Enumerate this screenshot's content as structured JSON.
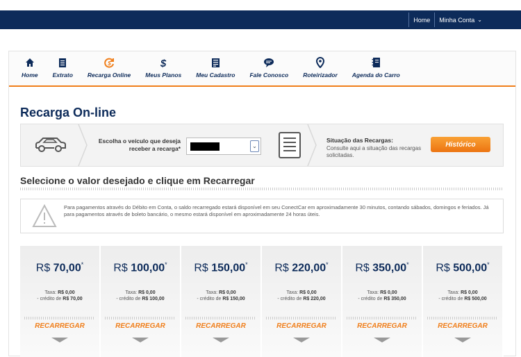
{
  "topnav": {
    "home": "Home",
    "account": "Minha Conta"
  },
  "menu": [
    {
      "label": "Home",
      "icon": "home-icon"
    },
    {
      "label": "Extrato",
      "icon": "statement-icon"
    },
    {
      "label": "Recarga Online",
      "icon": "recharge-icon"
    },
    {
      "label": "Meus Planos",
      "icon": "dollar-icon"
    },
    {
      "label": "Meu Cadastro",
      "icon": "register-icon"
    },
    {
      "label": "Fale Conosco",
      "icon": "chat-icon"
    },
    {
      "label": "Roteirizador",
      "icon": "map-pin-icon"
    },
    {
      "label": "Agenda do Carro",
      "icon": "agenda-icon"
    }
  ],
  "page_title": "Recarga On-line",
  "vehicle": {
    "label": "Escolha o veículo que deseja receber a recarga*"
  },
  "status": {
    "title": "Situação das Recargas:",
    "desc": "Consulte aqui a situação das recargas solicitadas.",
    "button": "Histórico"
  },
  "section_title": "Selecione o valor desejado e clique em Recarregar",
  "notice": "Para pagamentos através do Débito em Conta, o saldo recarregado estará disponível em seu ConectCar em aproximadamente 30 minutos, contando sábados, domingos e feriados. Já para pagamentos através de boleto bancário, o mesmo estará disponível em aproximadamente 24 horas úteis.",
  "currency": "R$",
  "tax_label": "Taxa:",
  "credit_label": "- crédito de",
  "recharge_label": "RECARREGAR",
  "options": [
    {
      "amount": "70,00",
      "tax": "R$ 0,00",
      "credit": "R$ 70,00"
    },
    {
      "amount": "100,00",
      "tax": "R$ 0,00",
      "credit": "R$ 100,00"
    },
    {
      "amount": "150,00",
      "tax": "R$ 0,00",
      "credit": "R$ 150,00"
    },
    {
      "amount": "220,00",
      "tax": "R$ 0,00",
      "credit": "R$ 220,00"
    },
    {
      "amount": "350,00",
      "tax": "R$ 0,00",
      "credit": "R$ 350,00"
    },
    {
      "amount": "500,00",
      "tax": "R$ 0,00",
      "credit": "R$ 500,00"
    }
  ],
  "colors": {
    "navy": "#0d2b5a",
    "orange": "#f07e1a"
  }
}
